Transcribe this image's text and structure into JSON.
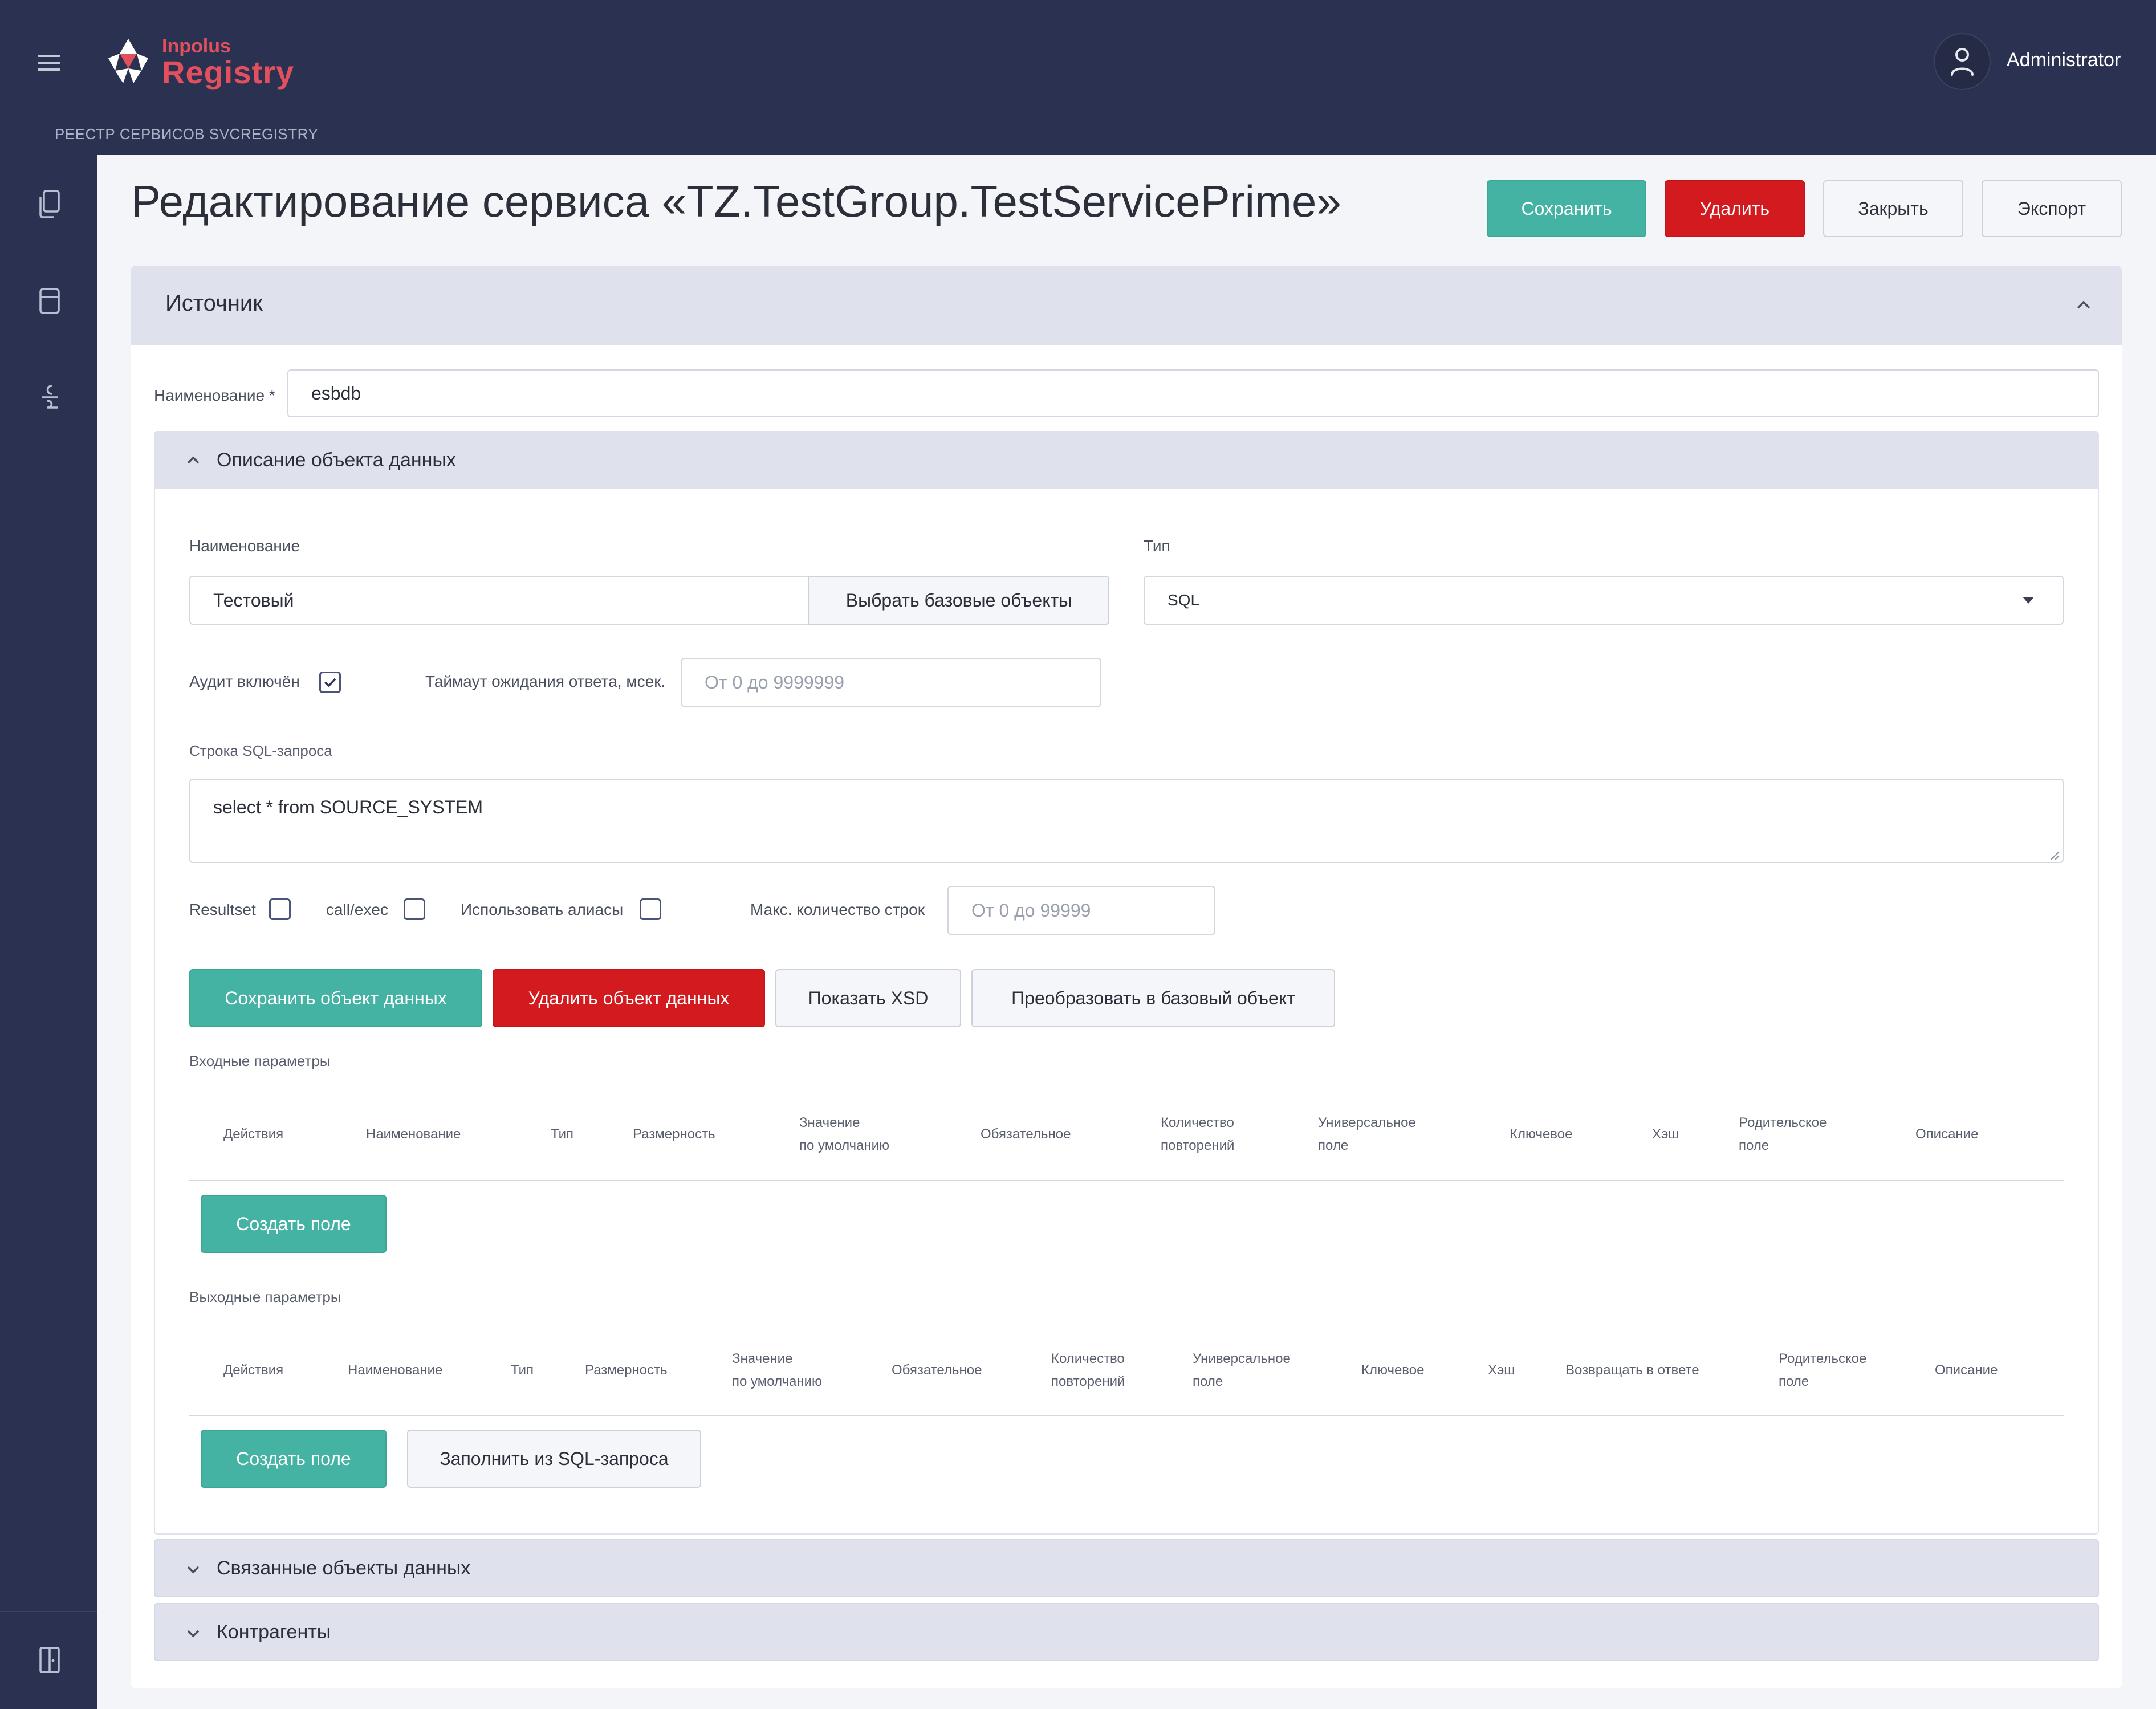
{
  "header": {
    "logo_small": "Inpolus",
    "logo_big": "Registry",
    "subtitle": "РЕЕСТР СЕРВИСОВ SVCREGISTRY",
    "user": "Administrator"
  },
  "page": {
    "title": "Редактирование сервиса «TZ.TestGroup.TestServicePrime»",
    "buttons": {
      "save": "Сохранить",
      "delete": "Удалить",
      "close": "Закрыть",
      "export": "Экспорт"
    }
  },
  "source": {
    "title": "Источник",
    "name_label": "Наименование *",
    "name_value": "esbdb"
  },
  "data_object": {
    "title": "Описание объекта данных",
    "name_label": "Наименование",
    "name_value": "Тестовый",
    "choose_base_button": "Выбрать базовые объекты",
    "type_label": "Тип",
    "type_value": "SQL",
    "audit_label": "Аудит включён",
    "audit_checked": true,
    "timeout_label": "Таймаут ожидания ответа, мсек.",
    "timeout_placeholder": "От 0 до 9999999",
    "sql_label": "Строка SQL-запроса",
    "sql_value": "select * from SOURCE_SYSTEM",
    "resultset_label": "Resultset",
    "callexec_label": "call/exec",
    "aliases_label": "Использовать алиасы",
    "max_rows_label": "Макс. количество строк",
    "max_rows_placeholder": "От 0 до 99999",
    "actions": {
      "save": "Сохранить объект данных",
      "delete": "Удалить объект данных",
      "show_xsd": "Показать XSD",
      "convert": "Преобразовать в базовый объект"
    }
  },
  "input_params": {
    "title": "Входные параметры",
    "columns": [
      "Действия",
      "Наименование",
      "Тип",
      "Размерность",
      "Значение\nпо умолчанию",
      "Обязательное",
      "Количество\nповторений",
      "Универсальное\nполе",
      "Ключевое",
      "Хэш",
      "Родительское\nполе",
      "Описание"
    ],
    "create_button": "Создать поле"
  },
  "output_params": {
    "title": "Выходные параметры",
    "columns": [
      "Действия",
      "Наименование",
      "Тип",
      "Размерность",
      "Значение\nпо умолчанию",
      "Обязательное",
      "Количество\nповторений",
      "Универсальное\nполе",
      "Ключевое",
      "Хэш",
      "Возвращать в ответе",
      "Родительское\nполе",
      "Описание"
    ],
    "create_button": "Создать поле",
    "fill_button": "Заполнить из SQL-запроса"
  },
  "related": {
    "title": "Связанные объекты данных"
  },
  "contractors": {
    "title": "Контрагенты"
  },
  "colors": {
    "header_bg": "#2b3150",
    "brand": "#e2505d",
    "primary": "#45b3a3",
    "danger": "#d21a1f",
    "section_bg": "#dfe2ec"
  }
}
